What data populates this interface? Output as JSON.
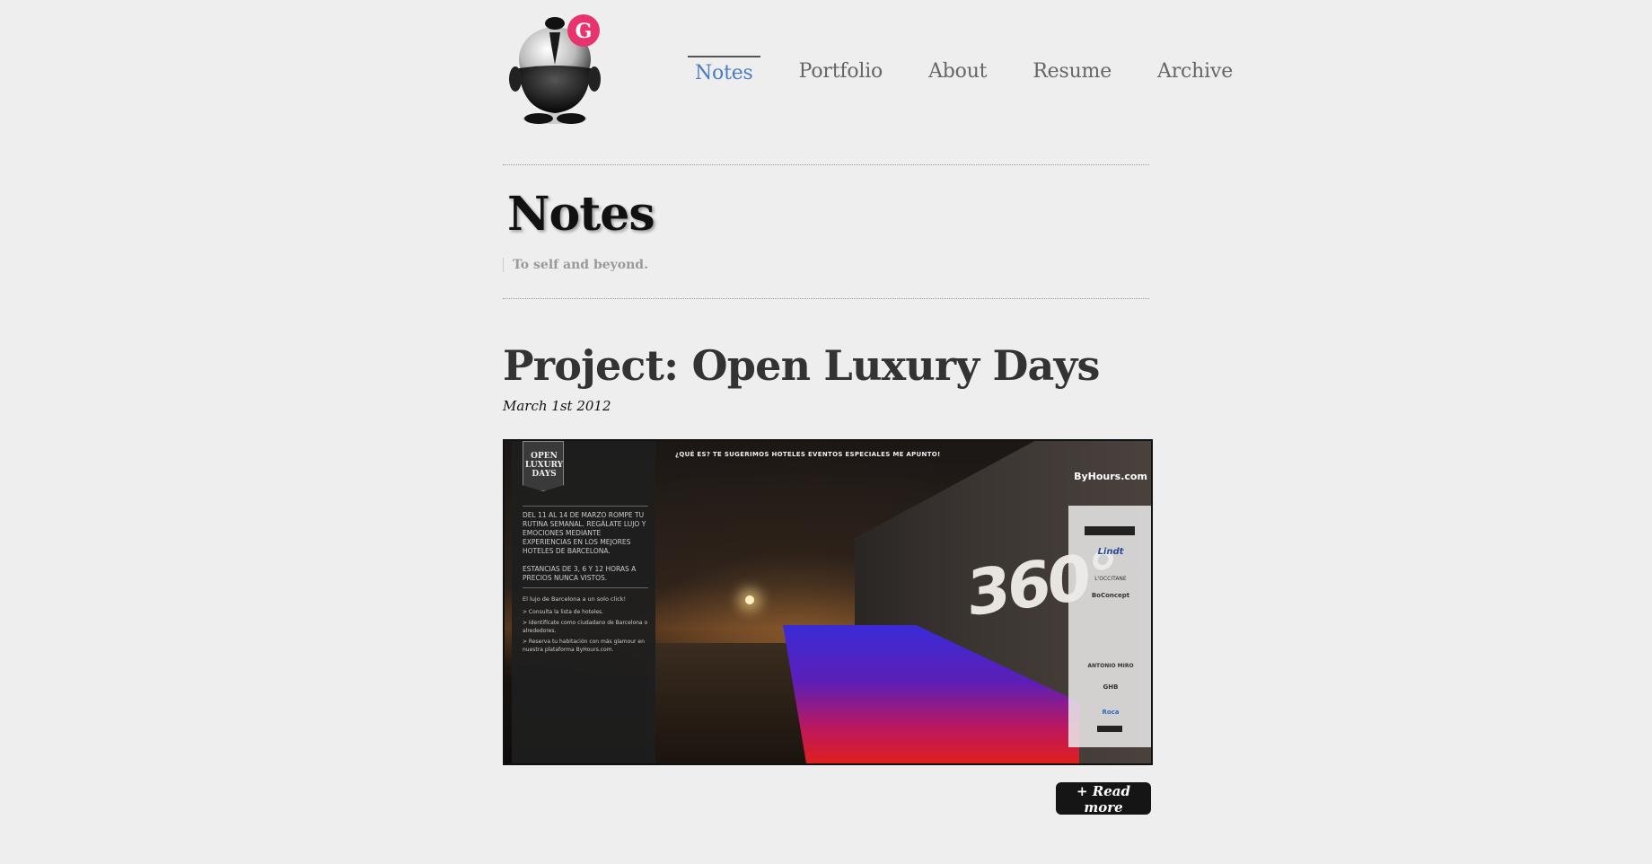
{
  "header": {
    "logo_letter": "G",
    "nav": [
      {
        "label": "Notes",
        "active": true
      },
      {
        "label": "Portfolio",
        "active": false
      },
      {
        "label": "About",
        "active": false
      },
      {
        "label": "Resume",
        "active": false
      },
      {
        "label": "Archive",
        "active": false
      }
    ]
  },
  "page": {
    "title": "Notes",
    "tagline": "To self and beyond."
  },
  "post": {
    "title": "Project: Open Luxury Days",
    "date": "March 1st 2012",
    "read_more": "+ Read more",
    "image": {
      "badge": "OPEN LUXURY DAYS",
      "intro": "DEL 11 AL 14 DE MARZO ROMPE TU RUTINA SEMANAL. REGÁLATE LUJO Y EMOCIONES MEDIANTE EXPERIENCIAS EN LOS MEJORES HOTELES DE BARCELONA.",
      "stays": "ESTANCIAS DE 3, 6 Y 12 HORAS A PRECIOS NUNCA VISTOS.",
      "click": "El lujo de Barcelona a un solo click!",
      "steps": [
        "> Consulta la lista de hoteles.",
        "> Identifícate como ciudadano de Barcelona o alrededores.",
        "> Reserva tu habitación con más glamour en nuestra plataforma ByHours.com."
      ],
      "menu": "¿QUÉ ES?   TE SUGERIMOS   HOTELES   EVENTOS ESPECIALES   ME APUNTO!",
      "sign": "360°",
      "brand": "ByHours.com",
      "sponsors": [
        "Lindt",
        "L'OCCITANE",
        "BoConcept",
        "ANTONIO MIRO",
        "GHB",
        "Roca"
      ]
    }
  },
  "colors": {
    "background": "#eeeeee",
    "nav_active": "#4a7cc6",
    "nav_text": "#666666",
    "button_bg": "#151515",
    "logo_badge": "#e8336d"
  }
}
